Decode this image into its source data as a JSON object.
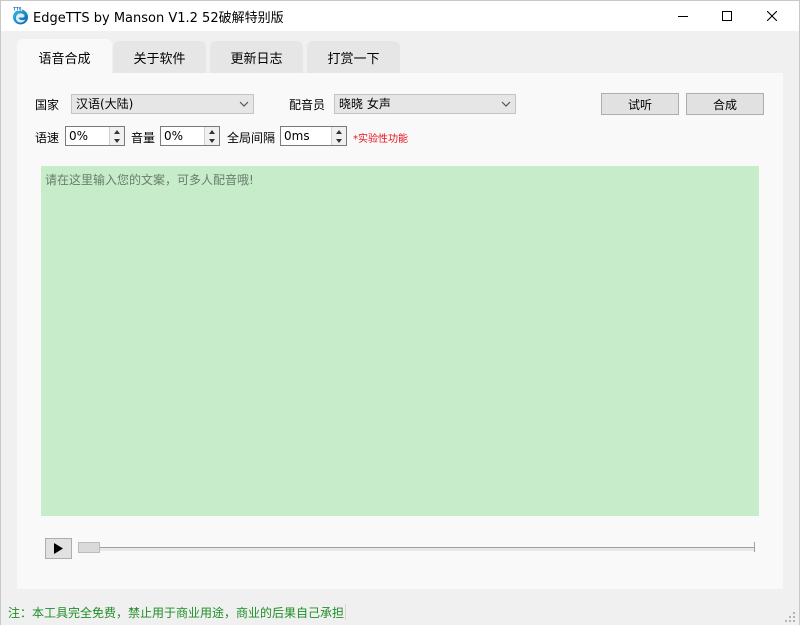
{
  "window": {
    "title": "EdgeTTS by Manson V1.2 52破解特别版"
  },
  "tabs": [
    {
      "label": "语音合成",
      "active": true
    },
    {
      "label": "关于软件",
      "active": false
    },
    {
      "label": "更新日志",
      "active": false
    },
    {
      "label": "打赏一下",
      "active": false
    }
  ],
  "controls": {
    "country_label": "国家",
    "country_value": "汉语(大陆)",
    "voice_label": "配音员",
    "voice_value": "晓晓 女声",
    "preview_button": "试听",
    "synthesize_button": "合成",
    "rate_label": "语速",
    "rate_value": "0%",
    "volume_label": "音量",
    "volume_value": "0%",
    "gap_label": "全局间隔",
    "gap_value": "0ms",
    "experimental_note": "*实验性功能"
  },
  "editor": {
    "placeholder": "请在这里输入您的文案，可多人配音哦!"
  },
  "player": {
    "progress": 0
  },
  "statusbar": {
    "text": "注：本工具完全免费，禁止用于商业用途，商业的后果自己承担"
  },
  "colors": {
    "editor_bg": "#c6ecca",
    "status_text": "#1e8e26",
    "note_text": "#e8131c"
  },
  "icons": {
    "app": "edge-tts-icon",
    "play": "play-icon",
    "dropdown": "chevron-down-icon"
  }
}
